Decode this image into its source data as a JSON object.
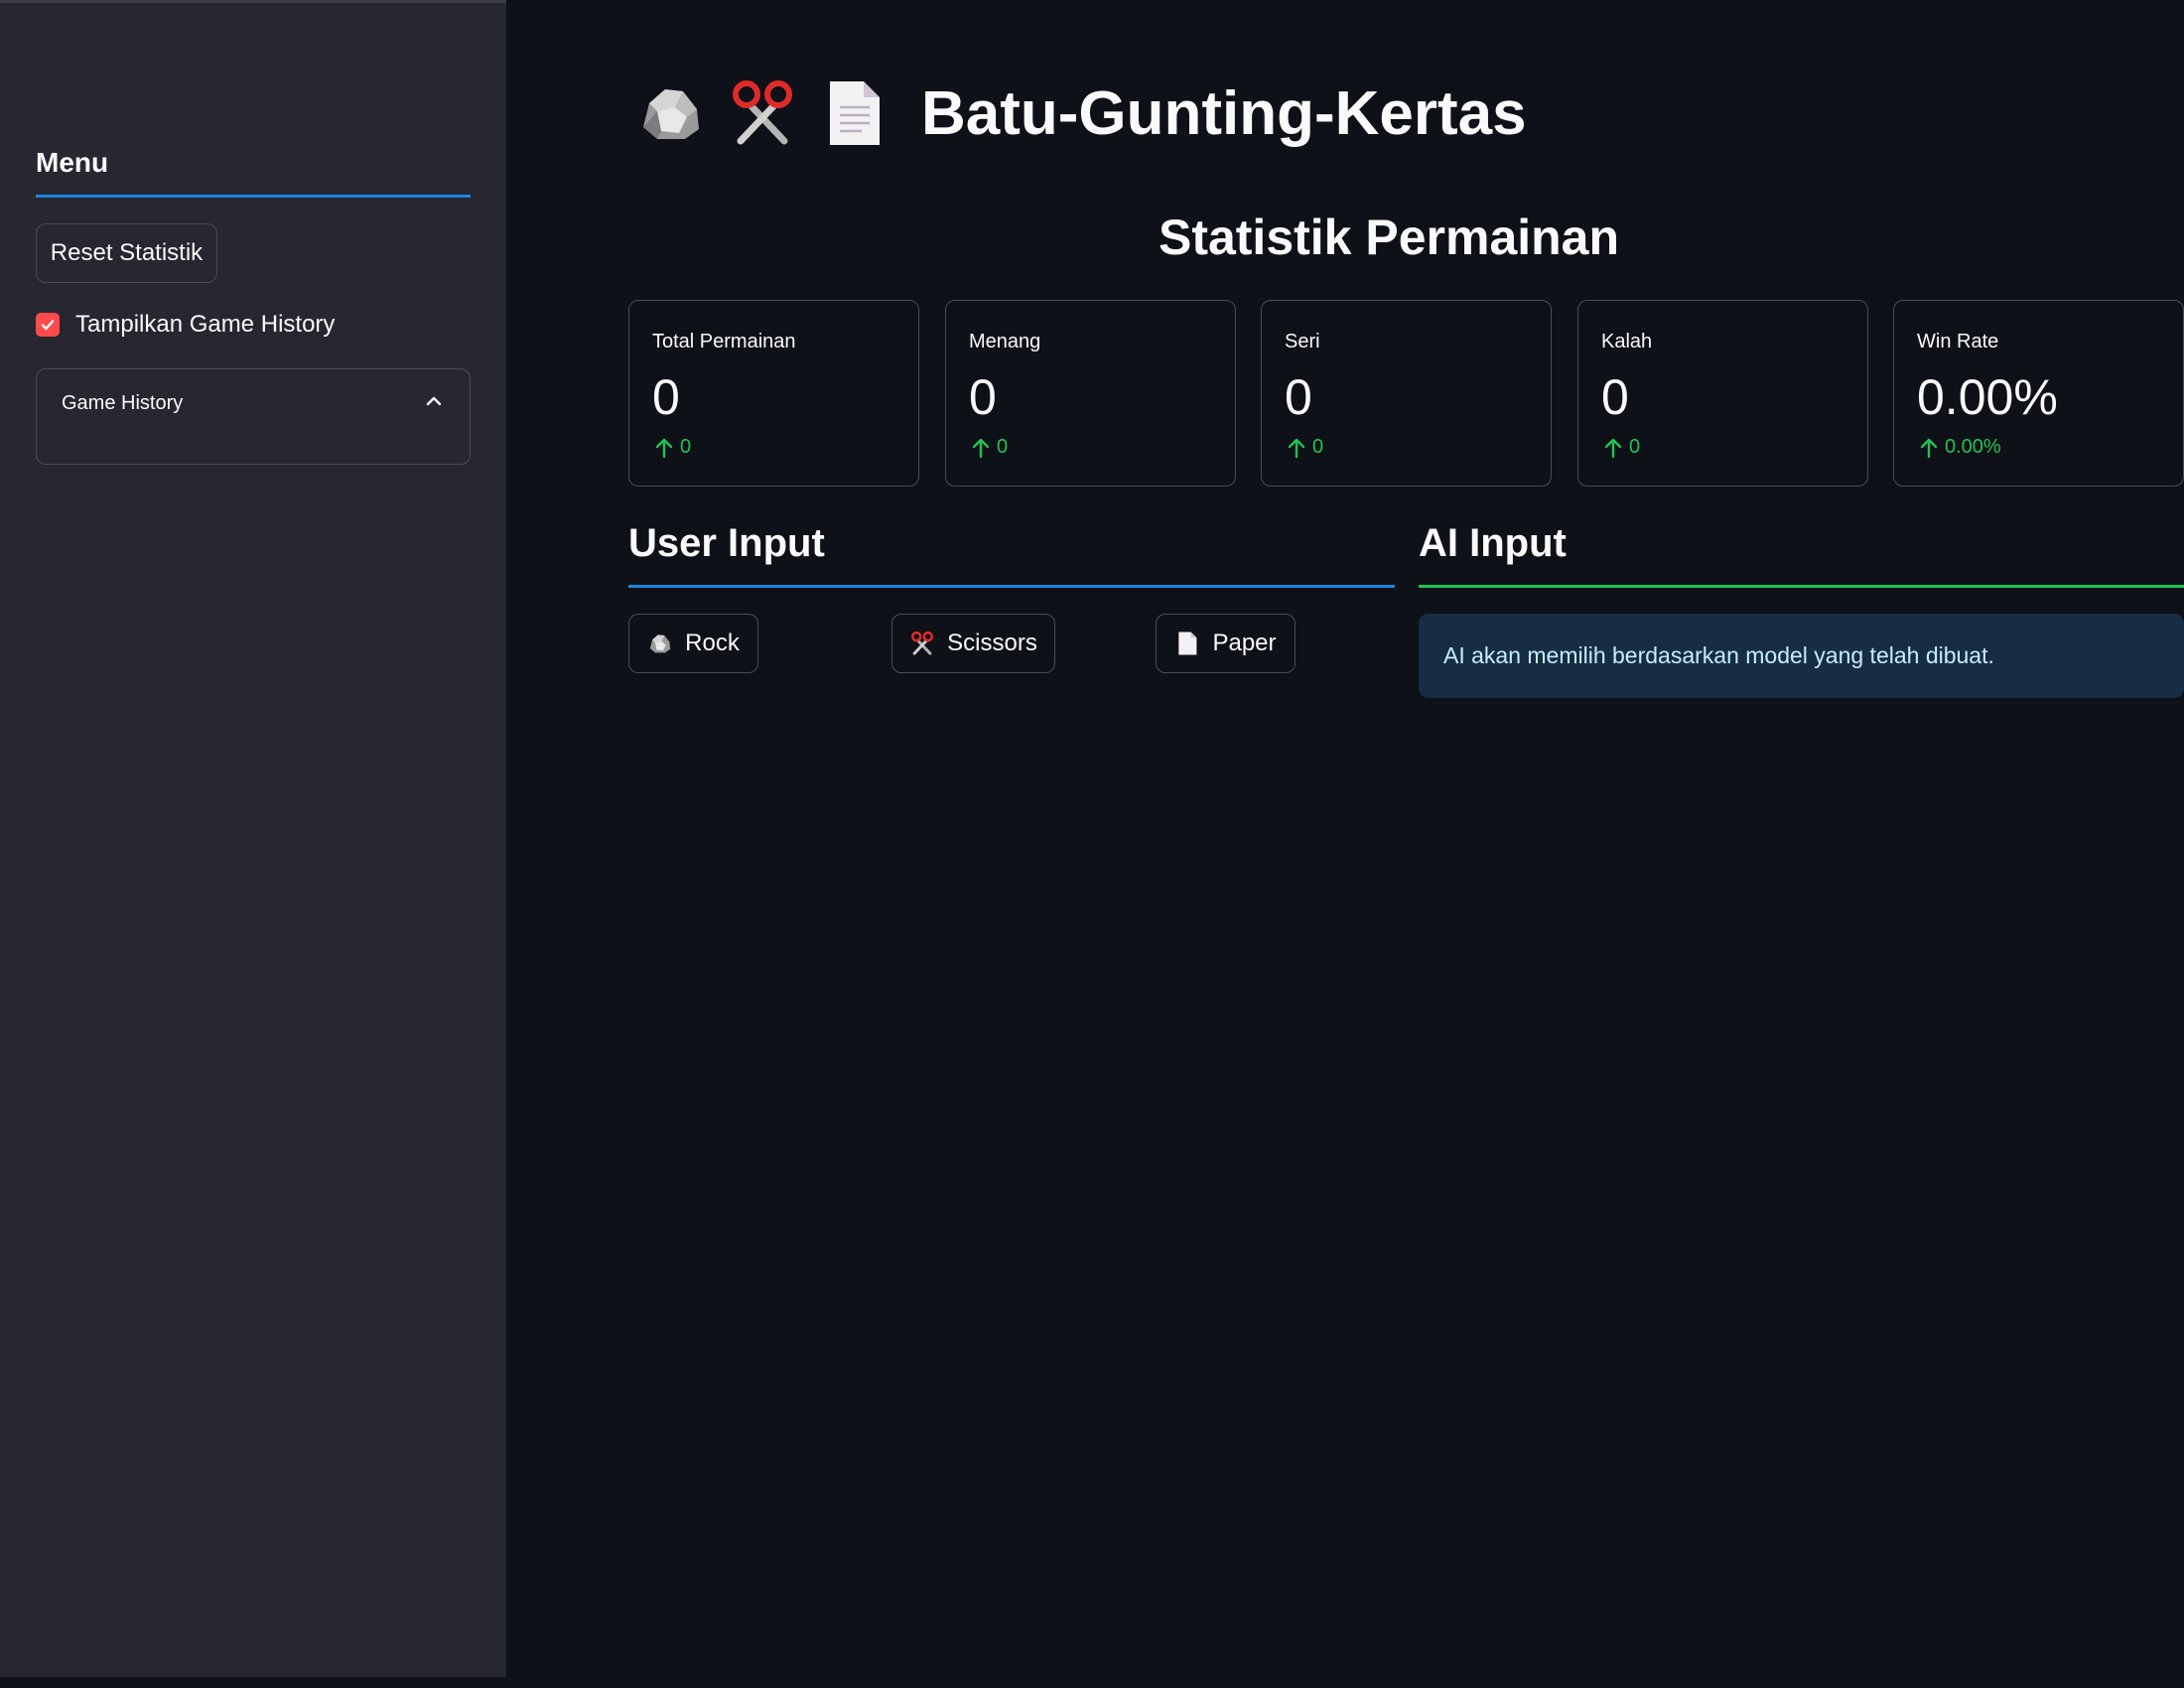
{
  "sidebar": {
    "title": "Menu",
    "reset_button": "Reset Statistik",
    "show_history_label": "Tampilkan Game History",
    "show_history_checked": true,
    "history_expander_label": "Game History"
  },
  "header": {
    "icons": [
      "rock-icon",
      "scissors-icon",
      "paper-icon"
    ],
    "title": "Batu-Gunting-Kertas"
  },
  "stats": {
    "heading": "Statistik Permainan",
    "metrics": [
      {
        "label": "Total Permainan",
        "value": "0",
        "delta": "0"
      },
      {
        "label": "Menang",
        "value": "0",
        "delta": "0"
      },
      {
        "label": "Seri",
        "value": "0",
        "delta": "0"
      },
      {
        "label": "Kalah",
        "value": "0",
        "delta": "0"
      },
      {
        "label": "Win Rate",
        "value": "0.00%",
        "delta": "0.00%"
      }
    ]
  },
  "user_input": {
    "heading": "User Input",
    "buttons": [
      {
        "label": "Rock",
        "icon": "rock-icon"
      },
      {
        "label": "Scissors",
        "icon": "scissors-icon"
      },
      {
        "label": "Paper",
        "icon": "paper-icon"
      }
    ]
  },
  "ai_input": {
    "heading": "AI Input",
    "info": "AI akan memilih berdasarkan model yang telah dibuat."
  },
  "colors": {
    "background": "#0e1117",
    "sidebar": "#262730",
    "accent_red": "#ff4b4b",
    "delta_green": "#21c354",
    "rule_blue": "#1c83e1",
    "info_bg": "#172d43"
  }
}
